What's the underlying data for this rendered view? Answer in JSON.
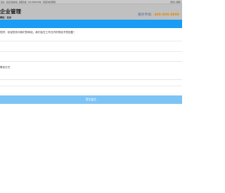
{
  "topbar": {
    "notice": "您好，欢迎光临本站！客服热线：400-8888-888，请保持电话畅通",
    "login": "[登录] [注册]"
  },
  "header": {
    "brand": "企业管理",
    "brand_sub": "网站 · 后台",
    "hotline_label": "服务专线：",
    "hotline_number": "400-888-8888"
  },
  "colors": {
    "nav": "#1a9cf4",
    "submit": "#7cc4f6",
    "header": "#c0c0c0",
    "topbar": "#c9c9c9"
  },
  "main": {
    "greeting": "您好，欢迎您访问我们的网站，我们会在工作日内尽快给予您回复！",
    "contact_label": "联系方式",
    "contact_value": "",
    "submit_label": "提交留言"
  }
}
